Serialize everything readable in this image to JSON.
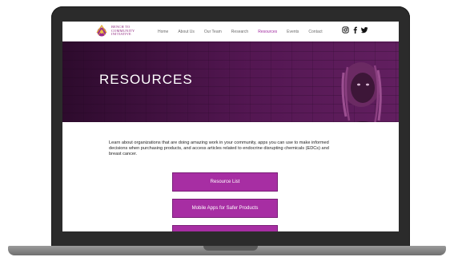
{
  "logo": {
    "line1": "BENCH TO",
    "line2": "COMMUNITY",
    "line3": "INITIATIVE"
  },
  "nav": {
    "items": [
      "Home",
      "About Us",
      "Our Team",
      "Research",
      "Resources",
      "Events",
      "Contact"
    ],
    "active": "Resources"
  },
  "social": {
    "icons": [
      "instagram-icon",
      "facebook-icon",
      "twitter-icon"
    ]
  },
  "hero": {
    "title": "RESOURCES"
  },
  "content": {
    "intro": "Learn about organizations that are doing amazing work in your community, apps you can use to make informed decisions when purchasing products, and access articles related to endocrine disrupting chemicals (EDCs) and breast cancer.",
    "buttons": [
      "Resource List",
      "Mobile Apps for Safer Products",
      ""
    ]
  },
  "colors": {
    "accent": "#a72ea3",
    "nav_active": "#a12aa0",
    "hero_overlay": "#4b1a48"
  }
}
